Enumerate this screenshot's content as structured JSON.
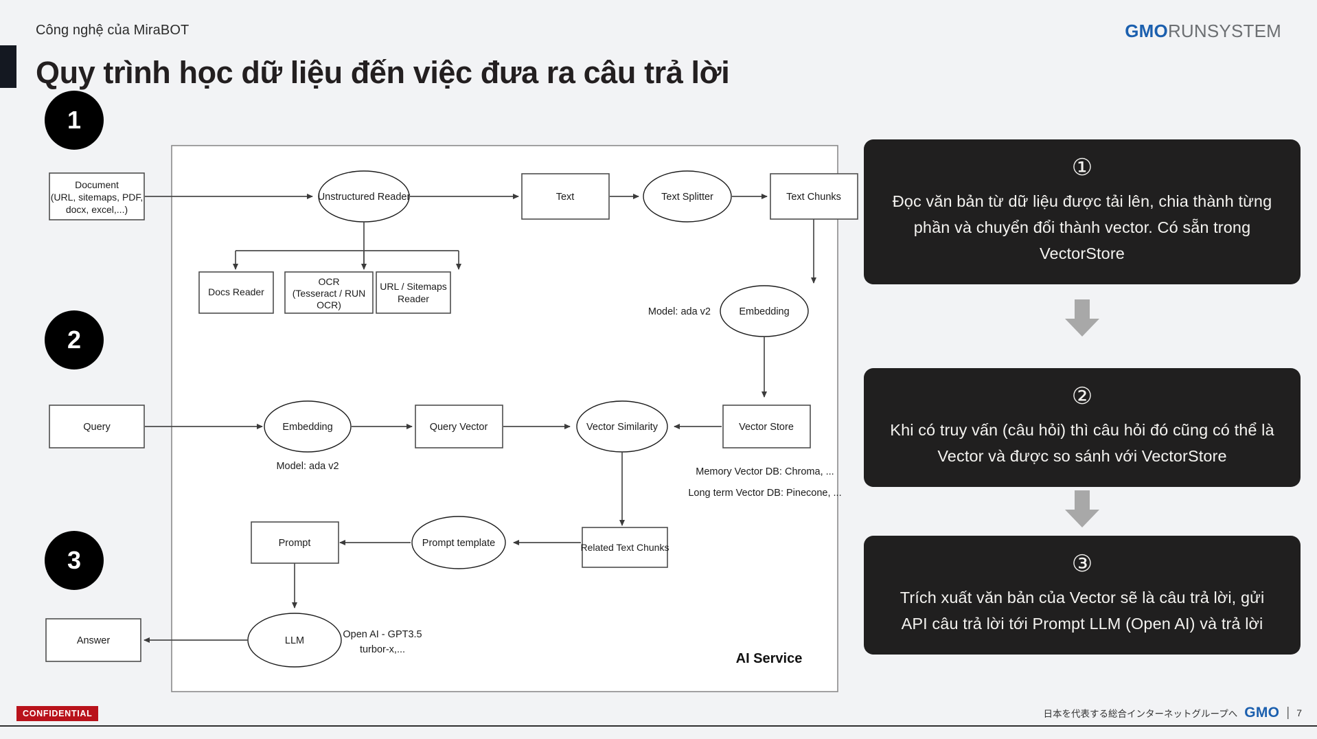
{
  "header": {
    "kicker": "Công nghệ của MiraBOT",
    "title": "Quy trình học dữ liệu đến việc đưa ra câu trả lời",
    "logo_primary": "GMO",
    "logo_secondary": "RUNSYSTEM",
    "logo_primary_color": "#1b5fae",
    "logo_secondary_color": "#6c6f72"
  },
  "steps": [
    {
      "number": "1"
    },
    {
      "number": "2"
    },
    {
      "number": "3"
    }
  ],
  "diagram": {
    "container_label": "AI Service",
    "nodes": {
      "document": "Document\n(URL, sitemaps, PDF,\ndocx, excel,...)",
      "document_l1": "Document",
      "document_l2": "(URL, sitemaps, PDF,",
      "document_l3": "docx, excel,...)",
      "unstructured_reader": "Unstructured Reader",
      "docs_reader": "Docs Reader",
      "ocr_l1": "OCR",
      "ocr_l2": "(Tesseract / RUN",
      "ocr_l3": "OCR)",
      "url_sitemaps_l1": "URL / Sitemaps",
      "url_sitemaps_l2": "Reader",
      "text": "Text",
      "text_splitter": "Text Splitter",
      "text_chunks": "Text Chunks",
      "embedding_top": "Embedding",
      "query": "Query",
      "embedding_mid": "Embedding",
      "query_vector": "Query Vector",
      "vector_similarity": "Vector Similarity",
      "vector_store": "Vector Store",
      "prompt": "Prompt",
      "prompt_template": "Prompt template",
      "related_text_chunks": "Related Text Chunks",
      "llm": "LLM",
      "answer": "Answer"
    },
    "annotations": {
      "model_top": "Model: ada v2",
      "model_mid": "Model: ada v2",
      "memory_vector_db": "Memory Vector DB: Chroma, ...",
      "long_term_vector_db": "Long term Vector DB: Pinecone, ...",
      "llm_model_l1": "Open AI - GPT3.5",
      "llm_model_l2": "turbor-x,..."
    }
  },
  "panel": {
    "accent_bg": "#201f1f",
    "arrow_color": "#a8a8a8",
    "cards": [
      {
        "number": "①",
        "text": "Đọc văn bản từ dữ liệu được tải lên, chia thành từng phần và chuyển đổi thành vector. Có sẵn trong VectorStore"
      },
      {
        "number": "②",
        "text": "Khi có truy vấn  (câu hỏi) thì câu hỏi đó cũng có thể là Vector và được so sánh với VectorStore"
      },
      {
        "number": "③",
        "text": "Trích xuất văn bản của Vector sẽ là câu trả lời, gửi API câu trả lời tới Prompt LLM (Open AI) và trả lời"
      }
    ]
  },
  "footer": {
    "confidential": "CONFIDENTIAL",
    "jp_text": "日本を代表する総合インターネットグループへ",
    "gmo": "GMO",
    "separator": "|",
    "page": "7"
  }
}
